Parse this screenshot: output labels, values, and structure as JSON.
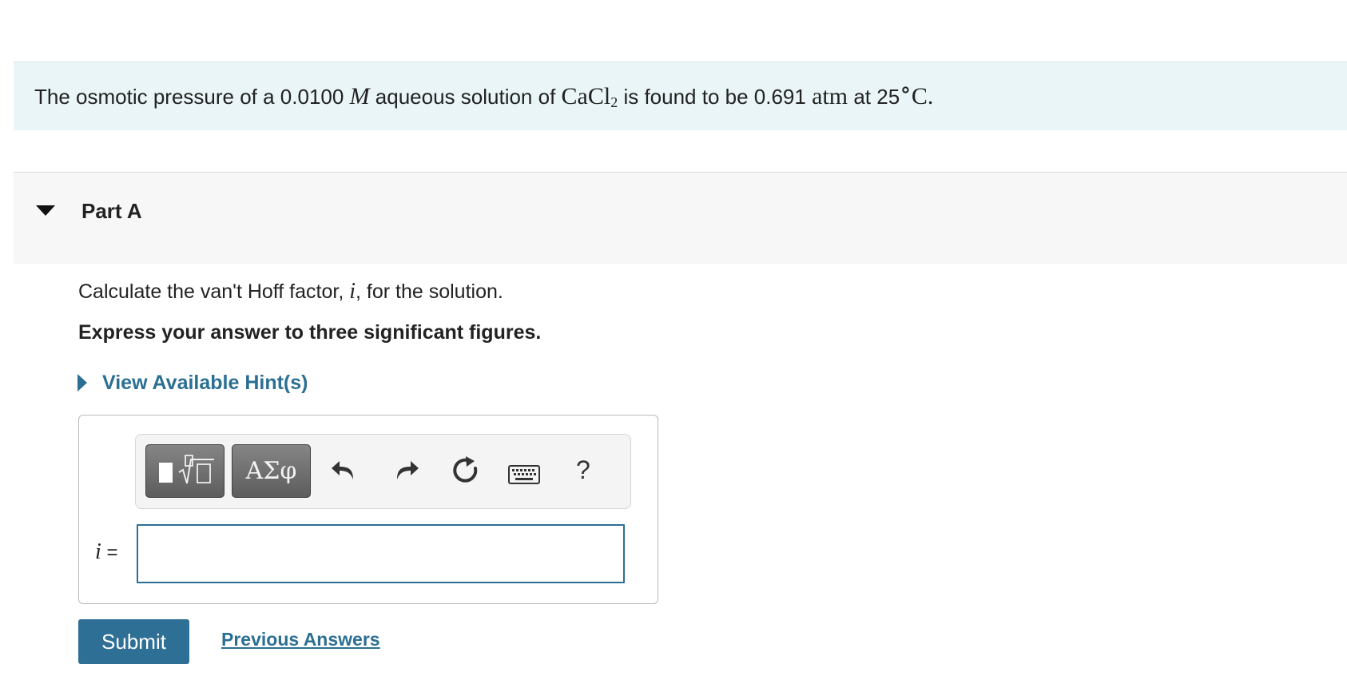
{
  "intro": {
    "text_before": "The osmotic pressure of a 0.0100",
    "unit_molar": "M",
    "text_mid": "aqueous solution of",
    "compound_base": "CaCl",
    "compound_sub": "2",
    "text_found": "is found to be 0.691",
    "unit_atm": "atm",
    "text_at": "at 25",
    "degree": "∘",
    "unit_celsius": "C."
  },
  "part": {
    "title": "Part A"
  },
  "question": {
    "text_before": "Calculate the van't Hoff factor,",
    "variable": "i",
    "text_after": ", for the solution.",
    "instruction": "Express your answer to three significant figures."
  },
  "hint": {
    "label": "View Available Hint(s)"
  },
  "toolbar": {
    "greek_label": "ΑΣφ",
    "help_label": "?",
    "icons": [
      "templates-icon",
      "undo-icon",
      "redo-icon",
      "reset-icon",
      "keyboard-icon",
      "help-icon"
    ]
  },
  "answer": {
    "variable": "i",
    "equals": "=",
    "value": "",
    "placeholder": ""
  },
  "actions": {
    "submit_label": "Submit",
    "previous_answers_label": "Previous Answers"
  },
  "colors": {
    "accent": "#2b6f93",
    "intro_background": "#e9f5f6",
    "part_header_background": "#f7f7f7"
  }
}
